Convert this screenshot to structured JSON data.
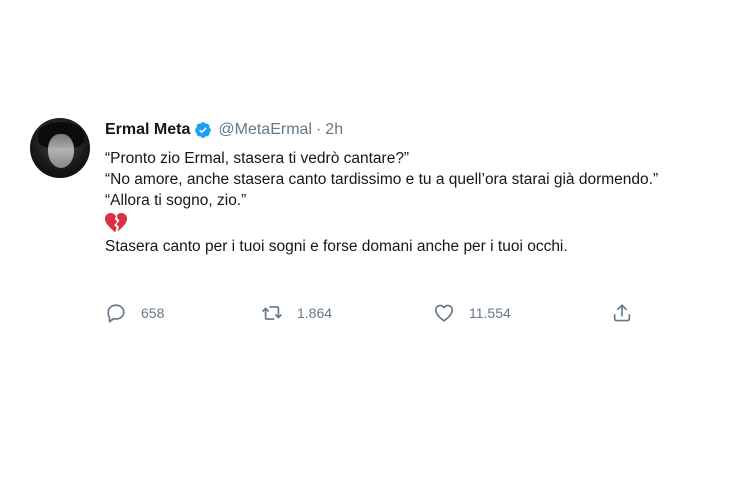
{
  "tweet": {
    "author_name": "Ermal Meta",
    "handle": "@MetaErmal",
    "separator": "·",
    "time": "2h",
    "lines": [
      "“Pronto zio Ermal, stasera ti vedrò cantare?”",
      "“No amore, anche stasera canto tardissimo e tu a quell’ora starai già dormendo.”",
      "“Allora ti sogno, zio.”"
    ],
    "emoji": "broken-heart-icon",
    "closing_line": "Stasera canto per i tuoi sogni e forse domani anche per i tuoi occhi.",
    "actions": {
      "replies": "658",
      "retweets": "1.864",
      "likes": "11.554"
    }
  },
  "colors": {
    "text": "#14171a",
    "muted": "#657786",
    "verified": "#1da1f2",
    "heart": "#e0245e"
  }
}
